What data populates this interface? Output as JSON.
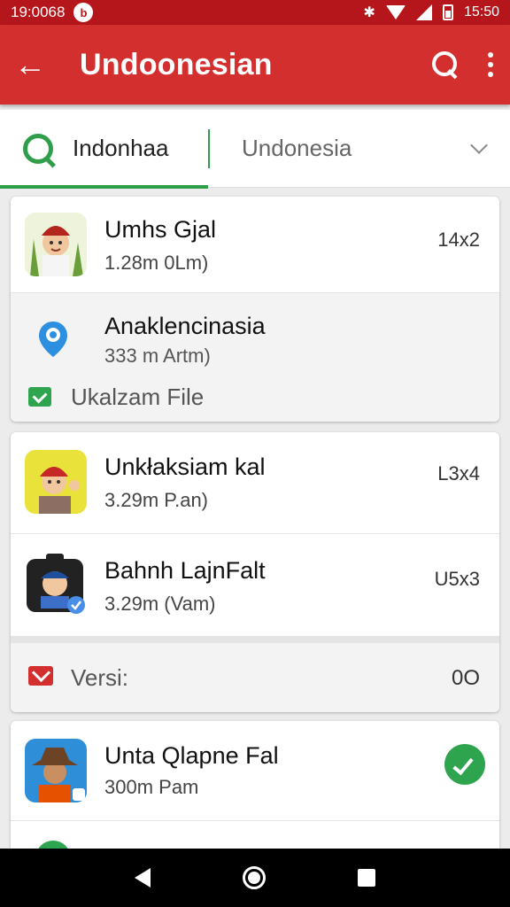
{
  "status_bar": {
    "time": "19:0068",
    "notif_glyph": "b",
    "right_time": "15:50"
  },
  "app_bar": {
    "back_glyph": "←",
    "title": "Undoonesian"
  },
  "tabs": {
    "active_label": "Indonhaa",
    "select_value": "Undonesia"
  },
  "groups": [
    {
      "items": [
        {
          "name": "Umhs Gjal",
          "sub": "1.28m 0Lm)",
          "meta": "14x2"
        },
        {
          "name": "Anaklencinasia",
          "sub": "333 m Artm)"
        }
      ],
      "footer": "Ukalzam File"
    },
    {
      "items": [
        {
          "name": "Unkłaksiam kal",
          "sub": "3.29m P.an)",
          "meta": "L3x4"
        },
        {
          "name": "Bahnh LajnFalt",
          "sub": "3.29m (Vam)",
          "meta": "U5x3"
        }
      ],
      "footer": "Versi:",
      "footer_meta": "0O"
    },
    {
      "items": [
        {
          "name": "Unta Qlapne Fal",
          "sub": "300m Pam"
        }
      ]
    }
  ],
  "colors": {
    "primary": "#d32f2f",
    "status": "#b5161b",
    "accent": "#2e9e4a"
  },
  "icons": [
    "back-arrow-icon",
    "search-icon",
    "more-vert-icon",
    "q-logo-icon",
    "chevron-down-icon",
    "location-pin-icon",
    "check-box-icon",
    "mail-icon",
    "done-check-icon"
  ]
}
